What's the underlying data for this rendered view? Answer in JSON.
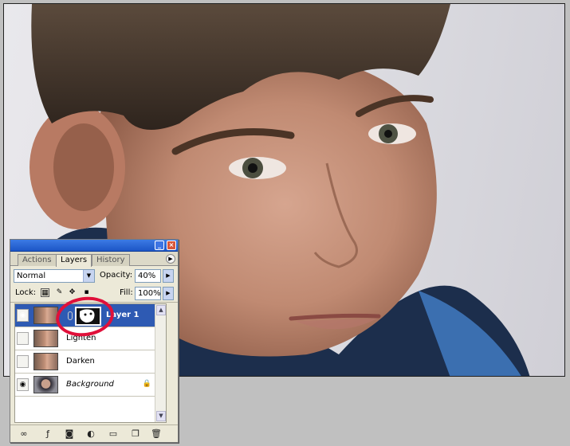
{
  "palette": {
    "tabs": [
      {
        "label": "Actions",
        "active": false
      },
      {
        "label": "Layers",
        "active": true
      },
      {
        "label": "History",
        "active": false
      }
    ],
    "blend_mode": "Normal",
    "opacity_label": "Opacity:",
    "opacity_value": "40%",
    "lock_label": "Lock:",
    "fill_label": "Fill:",
    "fill_value": "100%",
    "layers": [
      {
        "name": "Layer 1",
        "visible": true,
        "selected": true,
        "has_mask": true
      },
      {
        "name": "Lighten",
        "visible": false,
        "selected": false
      },
      {
        "name": "Darken",
        "visible": false,
        "selected": false
      },
      {
        "name": "Background",
        "visible": true,
        "selected": false,
        "locked": true
      }
    ],
    "bottom_icons": [
      "link-icon",
      "layer-style-icon",
      "add-mask-icon",
      "adjustment-layer-icon",
      "new-group-icon",
      "new-layer-icon",
      "trash-icon"
    ]
  },
  "colors": {
    "titlebar": "#1d56c7",
    "selected_row": "#2e5ab3",
    "annotation": "#e0103a",
    "panel_bg": "#ece9d8"
  }
}
